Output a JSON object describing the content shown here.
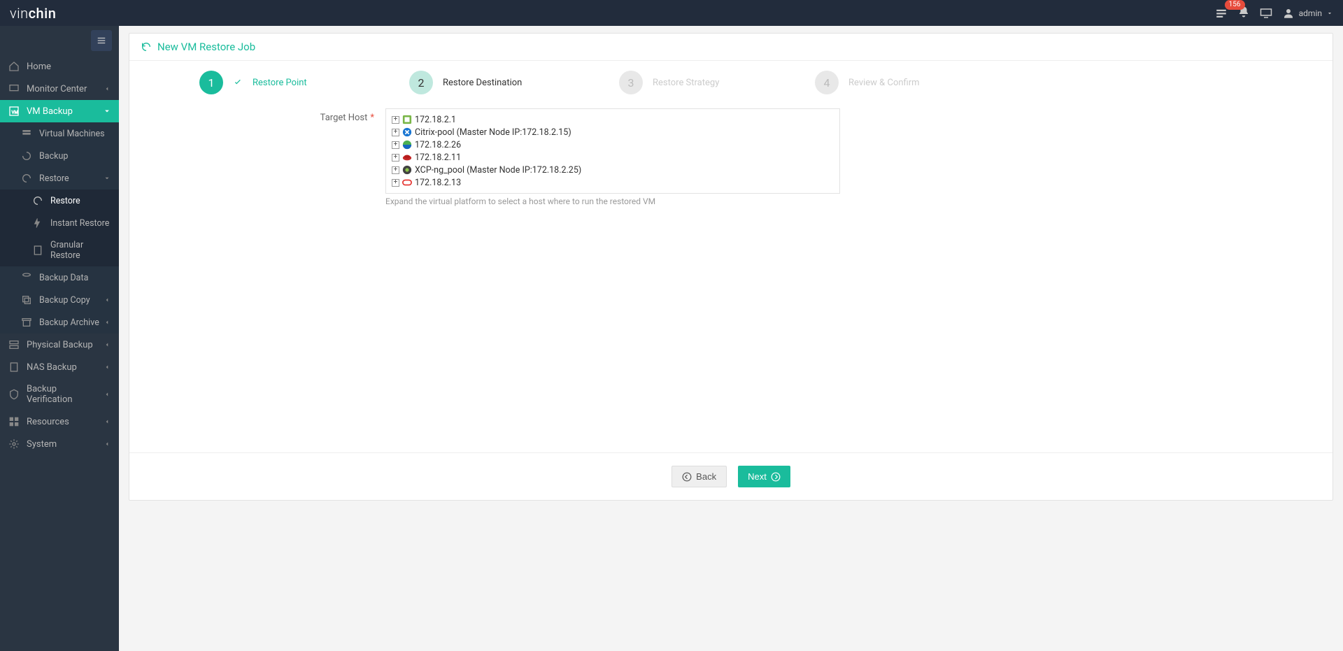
{
  "brand": {
    "part1": "vin",
    "part2": "chin"
  },
  "header": {
    "notif_count": "156",
    "user": "admin"
  },
  "sidebar": {
    "home": "Home",
    "monitor": "Monitor Center",
    "vm_backup": "VM Backup",
    "sub": {
      "vms": "Virtual Machines",
      "backup": "Backup",
      "restore": "Restore",
      "restore2": "Restore",
      "instant": "Instant Restore",
      "granular": "Granular Restore",
      "backup_data": "Backup Data",
      "backup_copy": "Backup Copy",
      "backup_archive": "Backup Archive"
    },
    "physical": "Physical Backup",
    "nas": "NAS Backup",
    "verification": "Backup Verification",
    "resources": "Resources",
    "system": "System"
  },
  "page": {
    "title": "New VM Restore Job",
    "steps": {
      "s1": "Restore Point",
      "s2": "Restore Destination",
      "s3": "Restore Strategy",
      "s4": "Review & Confirm"
    },
    "target_host_label": "Target Host",
    "hosts": [
      {
        "label": "172.18.2.1",
        "icon": "vmware"
      },
      {
        "label": "Citrix-pool (Master Node IP:172.18.2.15)",
        "icon": "citrix"
      },
      {
        "label": "172.18.2.26",
        "icon": "sangfor"
      },
      {
        "label": "172.18.2.11",
        "icon": "redhat"
      },
      {
        "label": "XCP-ng_pool (Master Node IP:172.18.2.25)",
        "icon": "xcp"
      },
      {
        "label": "172.18.2.13",
        "icon": "oracle"
      }
    ],
    "hint": "Expand the virtual platform to select a host where to run the restored VM",
    "back": "Back",
    "next": "Next"
  }
}
